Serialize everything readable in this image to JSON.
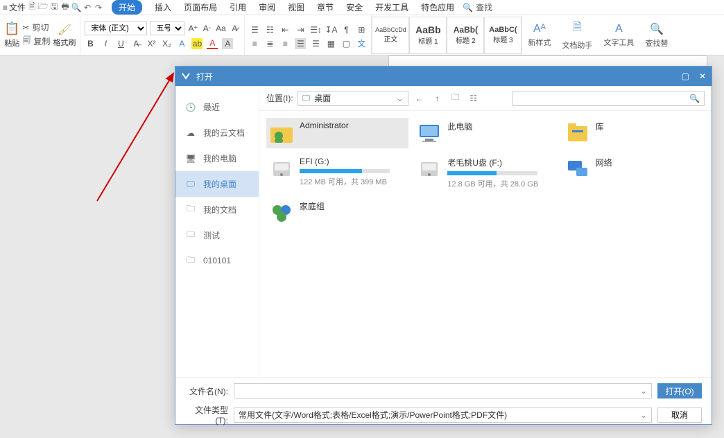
{
  "menubar": {
    "file": "文件",
    "tabs": [
      "开始",
      "插入",
      "页面布局",
      "引用",
      "审阅",
      "视图",
      "章节",
      "安全",
      "开发工具",
      "特色应用"
    ],
    "active_tab_index": 0,
    "search": "查找"
  },
  "ribbon": {
    "paste": "粘贴",
    "cut": "剪切",
    "copy": "复制",
    "format_painter": "格式刷",
    "font_name": "宋体 (正文)",
    "font_size": "五号",
    "styles": [
      {
        "preview": "AaBbCcDd",
        "name": "正文"
      },
      {
        "preview": "AaBb",
        "name": "标题 1"
      },
      {
        "preview": "AaBb(",
        "name": "标题 2"
      },
      {
        "preview": "AaBbC(",
        "name": "标题 3"
      }
    ],
    "new_style": "新样式",
    "doc_assist": "文档助手",
    "text_tools": "文字工具",
    "find_replace": "查找替"
  },
  "dialog": {
    "title": "打开",
    "sidebar": [
      {
        "label": "最近",
        "icon": "clock"
      },
      {
        "label": "我的云文档",
        "icon": "cloud"
      },
      {
        "label": "我的电脑",
        "icon": "monitor"
      },
      {
        "label": "我的桌面",
        "icon": "desktop",
        "active": true
      },
      {
        "label": "我的文档",
        "icon": "folder"
      },
      {
        "label": "测试",
        "icon": "folder"
      },
      {
        "label": "010101",
        "icon": "folder"
      }
    ],
    "location_label": "位置(I):",
    "location_value": "桌面",
    "search_placeholder": "",
    "items": [
      {
        "kind": "user",
        "name": "Administrator",
        "selected": true
      },
      {
        "kind": "pc",
        "name": "此电脑"
      },
      {
        "kind": "lib",
        "name": "库"
      },
      {
        "kind": "drive",
        "name": "EFI (G:)",
        "sub": "122 MB 可用，共 399 MB",
        "pct": 69
      },
      {
        "kind": "drive",
        "name": "老毛桃U盘 (F:)",
        "sub": "12.8 GB 可用，共 28.0 GB",
        "pct": 54
      },
      {
        "kind": "net",
        "name": "网络"
      },
      {
        "kind": "group",
        "name": "家庭组"
      }
    ],
    "filename_label": "文件名(N):",
    "filename_value": "",
    "filetype_label": "文件类型(T):",
    "filetype_value": "常用文件(文字/Word格式;表格/Excel格式;演示/PowerPoint格式;PDF文件)",
    "open_btn": "打开(O)",
    "cancel_btn": "取消"
  }
}
